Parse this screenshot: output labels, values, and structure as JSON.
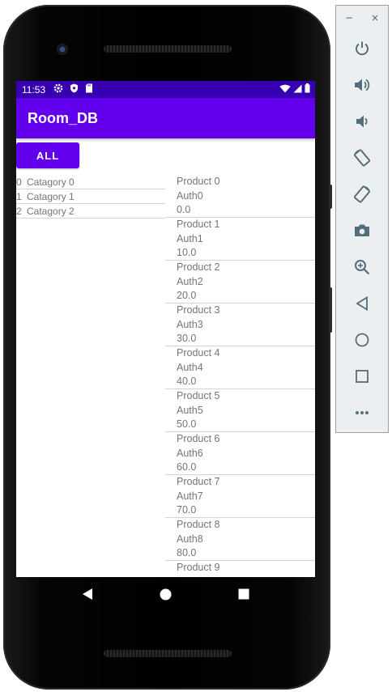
{
  "status_bar": {
    "time": "11:53",
    "icons": [
      "gear-icon",
      "shield-icon",
      "sd-card-icon"
    ],
    "right_icons": [
      "wifi-icon",
      "signal-icon",
      "battery-icon"
    ]
  },
  "app": {
    "title": "Room_DB",
    "colors": {
      "primary": "#6200ee",
      "primary_dark": "#3700b3"
    }
  },
  "all_button": {
    "label": "ALL"
  },
  "categories": [
    {
      "id": "0",
      "name": "Catagory 0"
    },
    {
      "id": "1",
      "name": "Catagory 1"
    },
    {
      "id": "2",
      "name": "Catagory 2"
    }
  ],
  "products": [
    {
      "name": "Product 0",
      "author": "Auth0",
      "price": "0.0"
    },
    {
      "name": "Product 1",
      "author": "Auth1",
      "price": "10.0"
    },
    {
      "name": "Product 2",
      "author": "Auth2",
      "price": "20.0"
    },
    {
      "name": "Product 3",
      "author": "Auth3",
      "price": "30.0"
    },
    {
      "name": "Product 4",
      "author": "Auth4",
      "price": "40.0"
    },
    {
      "name": "Product 5",
      "author": "Auth5",
      "price": "50.0"
    },
    {
      "name": "Product 6",
      "author": "Auth6",
      "price": "60.0"
    },
    {
      "name": "Product 7",
      "author": "Auth7",
      "price": "70.0"
    },
    {
      "name": "Product 8",
      "author": "Auth8",
      "price": "80.0"
    },
    {
      "name": "Product 9"
    }
  ],
  "nav_bar": [
    "back-icon",
    "home-icon",
    "recents-icon"
  ],
  "emulator_panel": {
    "window_controls": [
      "minimize-icon",
      "close-icon"
    ],
    "minimize_glyph": "−",
    "close_glyph": "×",
    "tools": [
      "power-icon",
      "volume-up-icon",
      "volume-down-icon",
      "rotate-left-icon",
      "rotate-right-icon",
      "camera-icon",
      "zoom-icon",
      "back-icon",
      "home-icon",
      "overview-icon",
      "more-icon"
    ]
  }
}
